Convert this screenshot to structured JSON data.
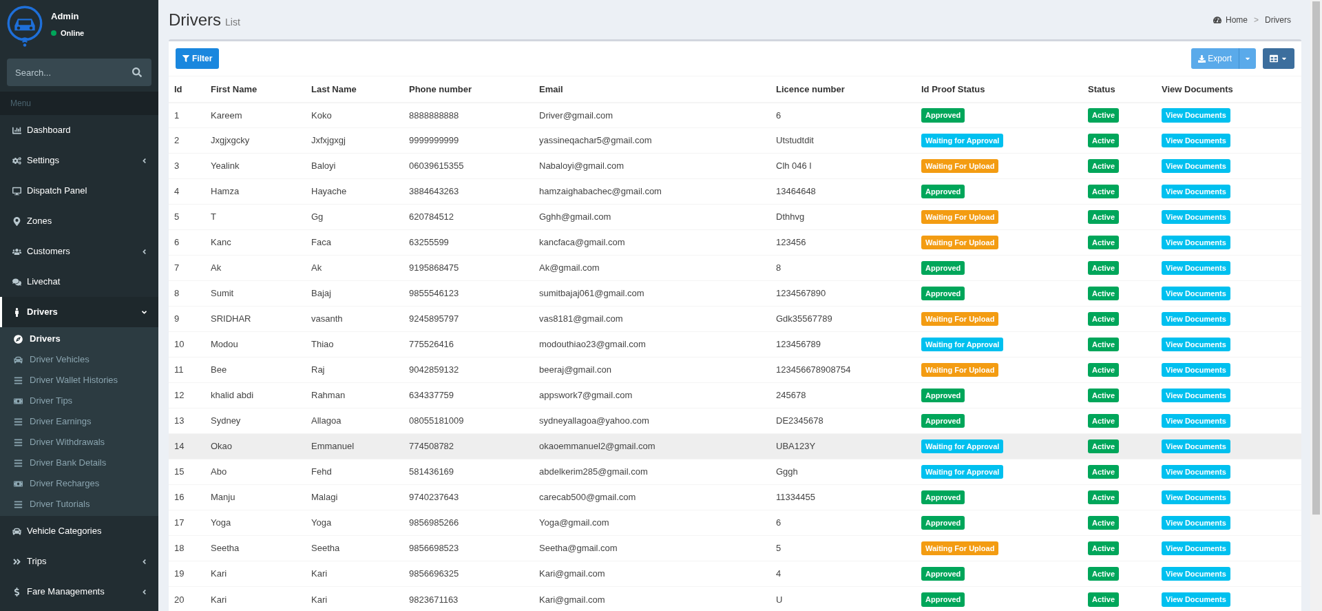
{
  "user": {
    "name": "Admin",
    "status": "Online"
  },
  "sidebar": {
    "search_placeholder": "Search...",
    "menu_header": "Menu",
    "items": [
      {
        "label": "Dashboard",
        "kind": "link",
        "selected": false
      },
      {
        "label": "Settings",
        "kind": "tree",
        "selected": false,
        "expanded": false
      },
      {
        "label": "Dispatch Panel",
        "kind": "link",
        "selected": false
      },
      {
        "label": "Zones",
        "kind": "link",
        "selected": false
      },
      {
        "label": "Customers",
        "kind": "tree",
        "selected": false,
        "expanded": false
      },
      {
        "label": "Livechat",
        "kind": "link",
        "selected": false
      },
      {
        "label": "Drivers",
        "kind": "tree",
        "selected": true,
        "expanded": true,
        "children": [
          {
            "label": "Drivers",
            "selected": true
          },
          {
            "label": "Driver Vehicles",
            "selected": false
          },
          {
            "label": "Driver Wallet Histories",
            "selected": false
          },
          {
            "label": "Driver Tips",
            "selected": false
          },
          {
            "label": "Driver Earnings",
            "selected": false
          },
          {
            "label": "Driver Withdrawals",
            "selected": false
          },
          {
            "label": "Driver Bank Details",
            "selected": false
          },
          {
            "label": "Driver Recharges",
            "selected": false
          },
          {
            "label": "Driver Tutorials",
            "selected": false
          }
        ]
      },
      {
        "label": "Vehicle Categories",
        "kind": "link",
        "selected": false
      },
      {
        "label": "Trips",
        "kind": "tree",
        "selected": false,
        "expanded": false
      },
      {
        "label": "Fare Managements",
        "kind": "tree",
        "selected": false,
        "expanded": false
      }
    ]
  },
  "page": {
    "title": "Drivers",
    "subtitle": "List",
    "breadcrumb": [
      "Home",
      "Drivers"
    ],
    "breadcrumb_separator": ">"
  },
  "toolbar": {
    "filter": "Filter",
    "export": "Export"
  },
  "table": {
    "columns": [
      "Id",
      "First Name",
      "Last Name",
      "Phone number",
      "Email",
      "Licence number",
      "Id Proof Status",
      "Status",
      "View Documents"
    ],
    "rows": [
      {
        "id": "1",
        "first": "Kareem",
        "last": "Koko",
        "phone": "8888888888",
        "email": "Driver@gmail.com",
        "licence": "6",
        "proof": {
          "label": "Approved",
          "kind": "approved"
        },
        "status": {
          "label": "Active",
          "kind": "active"
        },
        "action": "View Documents",
        "highlighted": false
      },
      {
        "id": "2",
        "first": "Jxgjxgcky",
        "last": "Jxfxjgxgj",
        "phone": "9999999999",
        "email": "yassineqachar5@gmail.com",
        "licence": "Utstudtdit",
        "proof": {
          "label": "Waiting for Approval",
          "kind": "pending"
        },
        "status": {
          "label": "Active",
          "kind": "active"
        },
        "action": "View Documents",
        "highlighted": false
      },
      {
        "id": "3",
        "first": "Yealink",
        "last": "Baloyi",
        "phone": "06039615355",
        "email": "Nabaloyi@gmail.com",
        "licence": "Clh 046 l",
        "proof": {
          "label": "Waiting For Upload",
          "kind": "upload"
        },
        "status": {
          "label": "Active",
          "kind": "active"
        },
        "action": "View Documents",
        "highlighted": false
      },
      {
        "id": "4",
        "first": "Hamza",
        "last": "Hayache",
        "phone": "3884643263",
        "email": "hamzaighabachec@gmail.com",
        "licence": "13464648",
        "proof": {
          "label": "Approved",
          "kind": "approved"
        },
        "status": {
          "label": "Active",
          "kind": "active"
        },
        "action": "View Documents",
        "highlighted": false
      },
      {
        "id": "5",
        "first": "T",
        "last": "Gg",
        "phone": "620784512",
        "email": "Gghh@gmail.com",
        "licence": "Dthhvg",
        "proof": {
          "label": "Waiting For Upload",
          "kind": "upload"
        },
        "status": {
          "label": "Active",
          "kind": "active"
        },
        "action": "View Documents",
        "highlighted": false
      },
      {
        "id": "6",
        "first": "Kanc",
        "last": "Faca",
        "phone": "63255599",
        "email": "kancfaca@gmail.com",
        "licence": "123456",
        "proof": {
          "label": "Waiting For Upload",
          "kind": "upload"
        },
        "status": {
          "label": "Active",
          "kind": "active"
        },
        "action": "View Documents",
        "highlighted": false
      },
      {
        "id": "7",
        "first": "Ak",
        "last": "Ak",
        "phone": "9195868475",
        "email": "Ak@gmail.com",
        "licence": "8",
        "proof": {
          "label": "Approved",
          "kind": "approved"
        },
        "status": {
          "label": "Active",
          "kind": "active"
        },
        "action": "View Documents",
        "highlighted": false
      },
      {
        "id": "8",
        "first": "Sumit",
        "last": "Bajaj",
        "phone": "9855546123",
        "email": "sumitbajaj061@gmail.com",
        "licence": "1234567890",
        "proof": {
          "label": "Approved",
          "kind": "approved"
        },
        "status": {
          "label": "Active",
          "kind": "active"
        },
        "action": "View Documents",
        "highlighted": false
      },
      {
        "id": "9",
        "first": "SRIDHAR",
        "last": "vasanth",
        "phone": "9245895797",
        "email": "vas8181@gmail.com",
        "licence": "Gdk35567789",
        "proof": {
          "label": "Waiting For Upload",
          "kind": "upload"
        },
        "status": {
          "label": "Active",
          "kind": "active"
        },
        "action": "View Documents",
        "highlighted": false
      },
      {
        "id": "10",
        "first": "Modou",
        "last": "Thiao",
        "phone": "775526416",
        "email": "modouthiao23@gmail.com",
        "licence": "123456789",
        "proof": {
          "label": "Waiting for Approval",
          "kind": "pending"
        },
        "status": {
          "label": "Active",
          "kind": "active"
        },
        "action": "View Documents",
        "highlighted": false
      },
      {
        "id": "11",
        "first": "Bee",
        "last": "Raj",
        "phone": "9042859132",
        "email": "beeraj@gmail.con",
        "licence": "123456678908754",
        "proof": {
          "label": "Waiting For Upload",
          "kind": "upload"
        },
        "status": {
          "label": "Active",
          "kind": "active"
        },
        "action": "View Documents",
        "highlighted": false
      },
      {
        "id": "12",
        "first": "khalid abdi",
        "last": "Rahman",
        "phone": "634337759",
        "email": "appswork7@gmail.com",
        "licence": "245678",
        "proof": {
          "label": "Approved",
          "kind": "approved"
        },
        "status": {
          "label": "Active",
          "kind": "active"
        },
        "action": "View Documents",
        "highlighted": false
      },
      {
        "id": "13",
        "first": "Sydney",
        "last": "Allagoa",
        "phone": "08055181009",
        "email": "sydneyallagoa@yahoo.com",
        "licence": "DE2345678",
        "proof": {
          "label": "Approved",
          "kind": "approved"
        },
        "status": {
          "label": "Active",
          "kind": "active"
        },
        "action": "View Documents",
        "highlighted": false
      },
      {
        "id": "14",
        "first": "Okao",
        "last": "Emmanuel",
        "phone": "774508782",
        "email": "okaoemmanuel2@gmail.com",
        "licence": "UBA123Y",
        "proof": {
          "label": "Waiting for Approval",
          "kind": "pending"
        },
        "status": {
          "label": "Active",
          "kind": "active"
        },
        "action": "View Documents",
        "highlighted": true
      },
      {
        "id": "15",
        "first": "Abo",
        "last": "Fehd",
        "phone": "581436169",
        "email": "abdelkerim285@gmail.com",
        "licence": "Gggh",
        "proof": {
          "label": "Waiting for Approval",
          "kind": "pending"
        },
        "status": {
          "label": "Active",
          "kind": "active"
        },
        "action": "View Documents",
        "highlighted": false
      },
      {
        "id": "16",
        "first": "Manju",
        "last": "Malagi",
        "phone": "9740237643",
        "email": "carecab500@gmail.com",
        "licence": "11334455",
        "proof": {
          "label": "Approved",
          "kind": "approved"
        },
        "status": {
          "label": "Active",
          "kind": "active"
        },
        "action": "View Documents",
        "highlighted": false
      },
      {
        "id": "17",
        "first": "Yoga",
        "last": "Yoga",
        "phone": "9856985266",
        "email": "Yoga@gmail.com",
        "licence": "6",
        "proof": {
          "label": "Approved",
          "kind": "approved"
        },
        "status": {
          "label": "Active",
          "kind": "active"
        },
        "action": "View Documents",
        "highlighted": false
      },
      {
        "id": "18",
        "first": "Seetha",
        "last": "Seetha",
        "phone": "9856698523",
        "email": "Seetha@gmail.com",
        "licence": "5",
        "proof": {
          "label": "Waiting For Upload",
          "kind": "upload"
        },
        "status": {
          "label": "Active",
          "kind": "active"
        },
        "action": "View Documents",
        "highlighted": false
      },
      {
        "id": "19",
        "first": "Kari",
        "last": "Kari",
        "phone": "9856696325",
        "email": "Kari@gmail.com",
        "licence": "4",
        "proof": {
          "label": "Approved",
          "kind": "approved"
        },
        "status": {
          "label": "Active",
          "kind": "active"
        },
        "action": "View Documents",
        "highlighted": false
      },
      {
        "id": "20",
        "first": "Kari",
        "last": "Kari",
        "phone": "9823671163",
        "email": "Kari@gmail.com",
        "licence": "U",
        "proof": {
          "label": "Approved",
          "kind": "approved"
        },
        "status": {
          "label": "Active",
          "kind": "active"
        },
        "action": "View Documents",
        "highlighted": false
      }
    ]
  }
}
